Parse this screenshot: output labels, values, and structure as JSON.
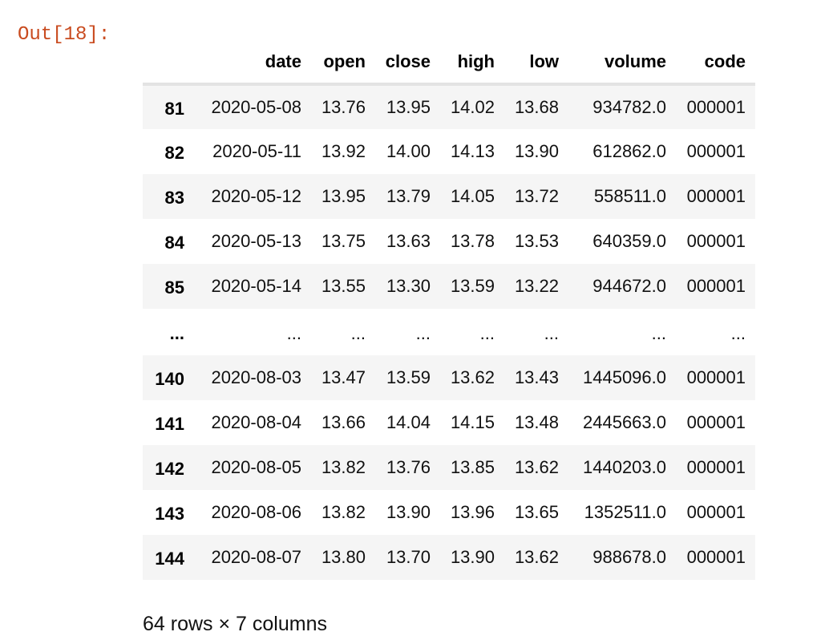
{
  "prompt": "Out[18]:",
  "dataframe": {
    "columns": [
      "date",
      "open",
      "close",
      "high",
      "low",
      "volume",
      "code"
    ],
    "rows": [
      {
        "index": "81",
        "cells": [
          "2020-05-08",
          "13.76",
          "13.95",
          "14.02",
          "13.68",
          "934782.0",
          "000001"
        ]
      },
      {
        "index": "82",
        "cells": [
          "2020-05-11",
          "13.92",
          "14.00",
          "14.13",
          "13.90",
          "612862.0",
          "000001"
        ]
      },
      {
        "index": "83",
        "cells": [
          "2020-05-12",
          "13.95",
          "13.79",
          "14.05",
          "13.72",
          "558511.0",
          "000001"
        ]
      },
      {
        "index": "84",
        "cells": [
          "2020-05-13",
          "13.75",
          "13.63",
          "13.78",
          "13.53",
          "640359.0",
          "000001"
        ]
      },
      {
        "index": "85",
        "cells": [
          "2020-05-14",
          "13.55",
          "13.30",
          "13.59",
          "13.22",
          "944672.0",
          "000001"
        ]
      },
      {
        "index": "...",
        "cells": [
          "...",
          "...",
          "...",
          "...",
          "...",
          "...",
          "..."
        ]
      },
      {
        "index": "140",
        "cells": [
          "2020-08-03",
          "13.47",
          "13.59",
          "13.62",
          "13.43",
          "1445096.0",
          "000001"
        ]
      },
      {
        "index": "141",
        "cells": [
          "2020-08-04",
          "13.66",
          "14.04",
          "14.15",
          "13.48",
          "2445663.0",
          "000001"
        ]
      },
      {
        "index": "142",
        "cells": [
          "2020-08-05",
          "13.82",
          "13.76",
          "13.85",
          "13.62",
          "1440203.0",
          "000001"
        ]
      },
      {
        "index": "143",
        "cells": [
          "2020-08-06",
          "13.82",
          "13.90",
          "13.96",
          "13.65",
          "1352511.0",
          "000001"
        ]
      },
      {
        "index": "144",
        "cells": [
          "2020-08-07",
          "13.80",
          "13.70",
          "13.90",
          "13.62",
          "988678.0",
          "000001"
        ]
      }
    ],
    "shape": "64 rows × 7 columns"
  },
  "colors": {
    "prompt": "#c94b1f",
    "stripe": "#f5f5f5",
    "header_rule": "#e3e3e3"
  }
}
